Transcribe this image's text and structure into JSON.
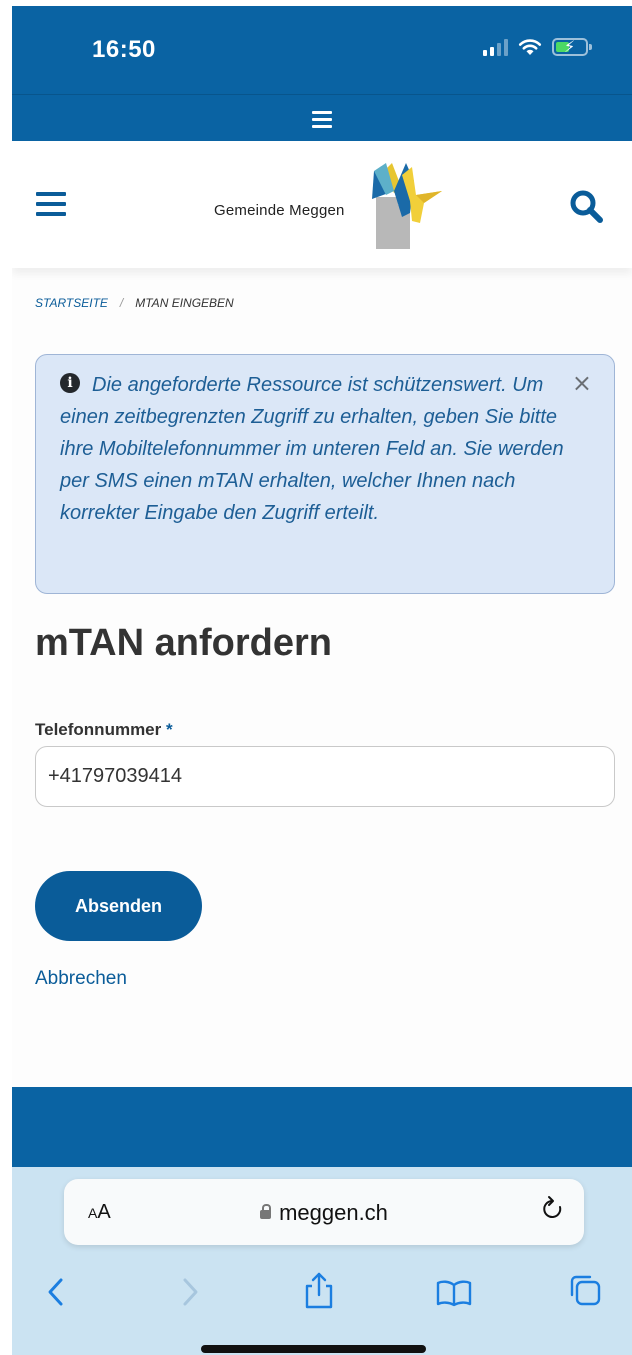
{
  "status_bar": {
    "time": "16:50"
  },
  "header": {
    "logo_text": "Gemeinde Meggen",
    "icons": {
      "menu": "hamburger-icon",
      "search": "search-icon",
      "logo": "meggen-coat-of-arms"
    }
  },
  "breadcrumb": {
    "home": "Startseite",
    "separator": "/",
    "current": "mTAN eingeben"
  },
  "alert": {
    "icon": "info-icon",
    "close_symbol": "×",
    "message": "Die angeforderte Ressource ist schützenswert. Um einen zeitbegrenzten Zugriff zu erhalten, geben Sie bitte ihre Mobiltelefonnummer im unteren Feld an. Sie werden per SMS einen mTAN erhalten, welcher Ihnen nach korrekter Eingabe den Zugriff erteilt."
  },
  "form": {
    "title": "mTAN anfordern",
    "phone_label": "Telefonnummer",
    "required_marker": "*",
    "phone_value": "+41797039414",
    "submit_label": "Absenden",
    "cancel_label": "Abbrechen"
  },
  "browser": {
    "text_size_small": "A",
    "text_size_large": "A",
    "url": "meggen.ch",
    "icons": [
      "back-icon",
      "forward-icon",
      "share-icon",
      "bookmarks-icon",
      "tabs-icon",
      "reload-icon",
      "lock-icon"
    ]
  },
  "colors": {
    "brand_blue": "#0a63a3",
    "link_blue": "#0a5c99",
    "alert_bg": "#dbe7f7",
    "safari_bar": "#cbe3f2"
  }
}
